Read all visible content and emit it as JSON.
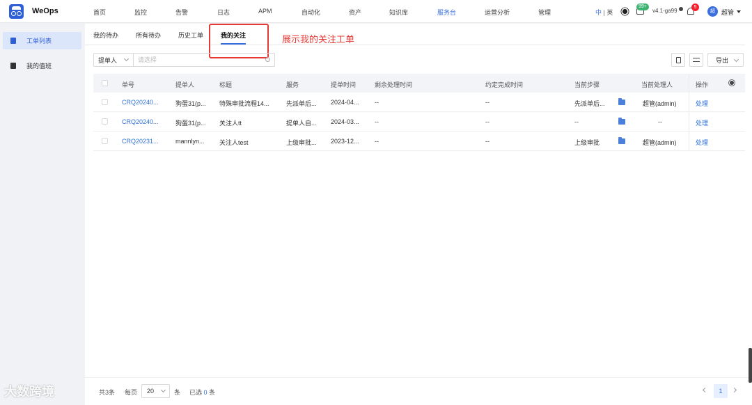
{
  "app": {
    "name": "WeOps"
  },
  "nav": {
    "items": [
      "首页",
      "监控",
      "告警",
      "日志",
      "APM",
      "自动化",
      "资产",
      "知识库",
      "服务台",
      "运营分析",
      "管理"
    ],
    "active": "服务台"
  },
  "topbar": {
    "lang_zh": "中",
    "lang_sep": " | ",
    "lang_en": "英",
    "msg_badge": "99+",
    "version": "v4.1-ga99",
    "notify_badge": "5",
    "avatar_text": "超",
    "user": "超管"
  },
  "sidebar": {
    "items": [
      {
        "label": "工单列表",
        "active": true
      },
      {
        "label": "我的值班",
        "active": false
      }
    ]
  },
  "tabs": [
    "我的待办",
    "所有待办",
    "历史工单",
    "我的关注"
  ],
  "active_tab": "我的关注",
  "annotation": "展示我的关注工单",
  "filter": {
    "field": "提单人",
    "placeholder": "请选择"
  },
  "toolbar": {
    "export_label": "导出"
  },
  "table": {
    "columns": [
      "单号",
      "提单人",
      "标题",
      "服务",
      "提单时间",
      "剩余处理时间",
      "约定完成时间",
      "当前步骤",
      "当前处理人",
      "操作"
    ],
    "rows": [
      {
        "id": "CRQ20240...",
        "submitter": "狗蛋31(p...",
        "title": "特殊审批流程14...",
        "service": "先派单后...",
        "time": "2024-04...",
        "remaining": "--",
        "deadline": "--",
        "step": "先派单后...",
        "handler": "超管(admin)",
        "action": "处理"
      },
      {
        "id": "CRQ20240...",
        "submitter": "狗蛋31(p...",
        "title": "关注人tt",
        "service": "提单人自...",
        "time": "2024-03...",
        "remaining": "--",
        "deadline": "--",
        "step": "--",
        "handler": "--",
        "action": "处理"
      },
      {
        "id": "CRQ20231...",
        "submitter": "mannlyn...",
        "title": "关注人test",
        "service": "上级审批...",
        "time": "2023-12...",
        "remaining": "--",
        "deadline": "--",
        "step": "上级审批",
        "handler": "超管(admin)",
        "action": "处理"
      }
    ]
  },
  "footer": {
    "total_prefix": "共",
    "total": "3",
    "total_suffix": "条",
    "per_page_label": "每页",
    "per_page": "20",
    "per_page_suffix": "条",
    "selected_prefix": "已选",
    "selected": "0",
    "selected_suffix": "条",
    "current_page": "1"
  },
  "watermark": "大数跨境",
  "colors": {
    "primary": "#3a6fe0",
    "annotation": "#e53935",
    "active_bg": "#dbe6fb"
  }
}
